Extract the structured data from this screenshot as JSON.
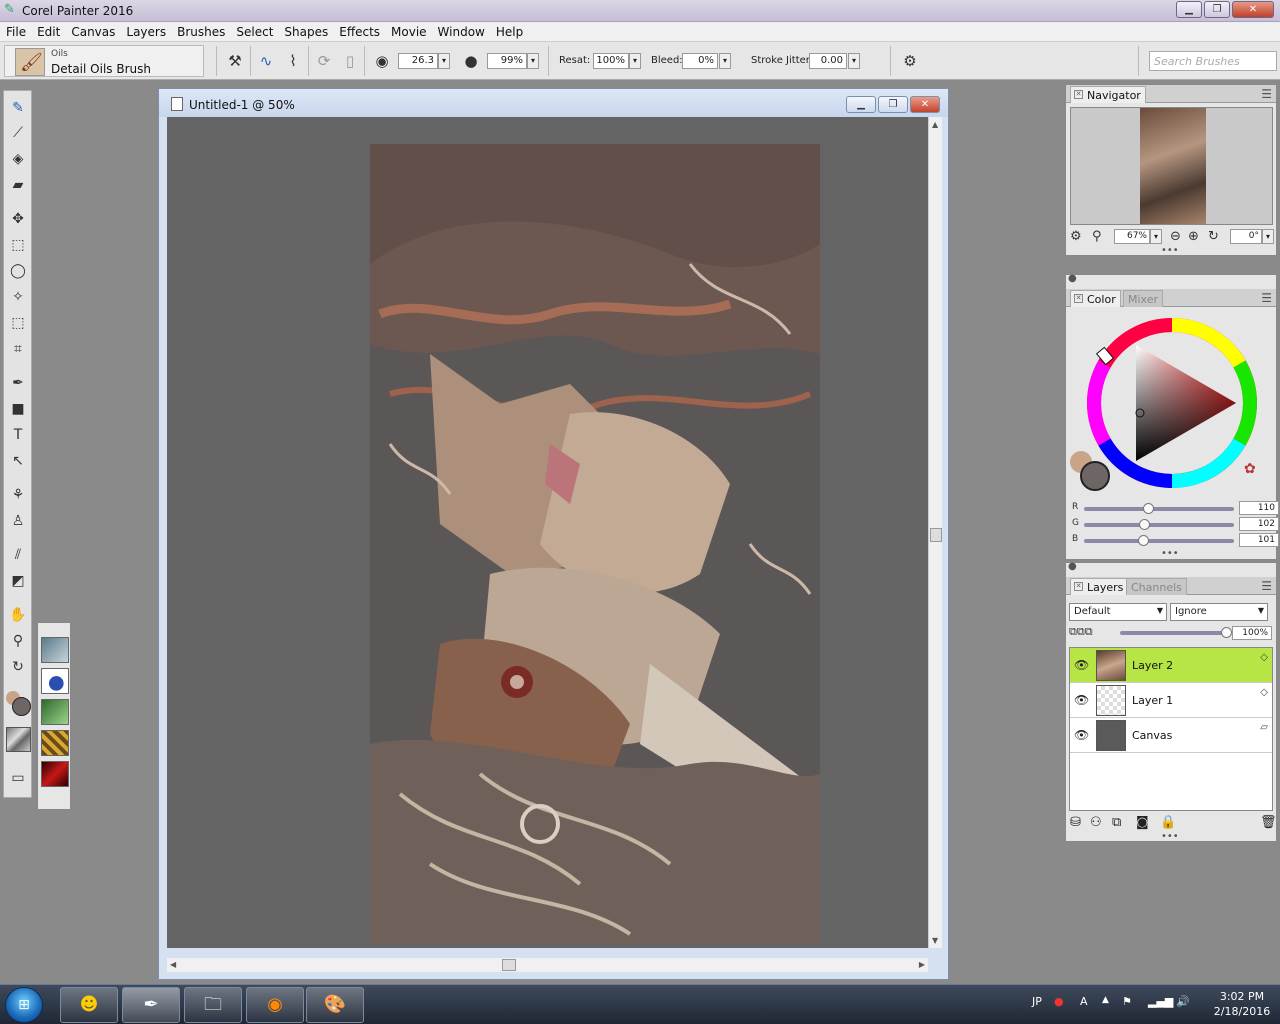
{
  "app": {
    "title": "Corel Painter 2016"
  },
  "menu": [
    "File",
    "Edit",
    "Canvas",
    "Layers",
    "Brushes",
    "Select",
    "Shapes",
    "Effects",
    "Movie",
    "Window",
    "Help"
  ],
  "brush": {
    "category": "Oils",
    "variant": "Detail Oils Brush"
  },
  "propbar": {
    "size": "26.3",
    "opacity": "99%",
    "resat_label": "Resat:",
    "resat": "100%",
    "bleed_label": "Bleed:",
    "bleed": "0%",
    "jitter_label": "Stroke Jitter:",
    "jitter": "0.00",
    "search_placeholder": "Search Brushes"
  },
  "document": {
    "title": "Untitled-1 @ 50%"
  },
  "navigator": {
    "title": "Navigator",
    "zoom": "67%",
    "rotation": "0°"
  },
  "color": {
    "tab": "Color",
    "tab2": "Mixer",
    "r_label": "R",
    "g_label": "G",
    "b_label": "B",
    "r": "110",
    "g": "102",
    "b": "101",
    "r_level": 0.431,
    "g_level": 0.4,
    "b_level": 0.396,
    "main_color": "#6e6665",
    "secondary_color": "#c9a488"
  },
  "layers": {
    "tab": "Layers",
    "tab2": "Channels",
    "composite_method": "Default",
    "preserve": "Ignore",
    "opacity": "100%",
    "opacity_level": 1.0,
    "items": [
      {
        "name": "Layer 2",
        "selected": true
      },
      {
        "name": "Layer 1",
        "selected": false
      },
      {
        "name": "Canvas",
        "selected": false
      }
    ]
  },
  "taskbar": {
    "lang": "JP",
    "time": "3:02 PM",
    "date": "2/18/2016"
  }
}
